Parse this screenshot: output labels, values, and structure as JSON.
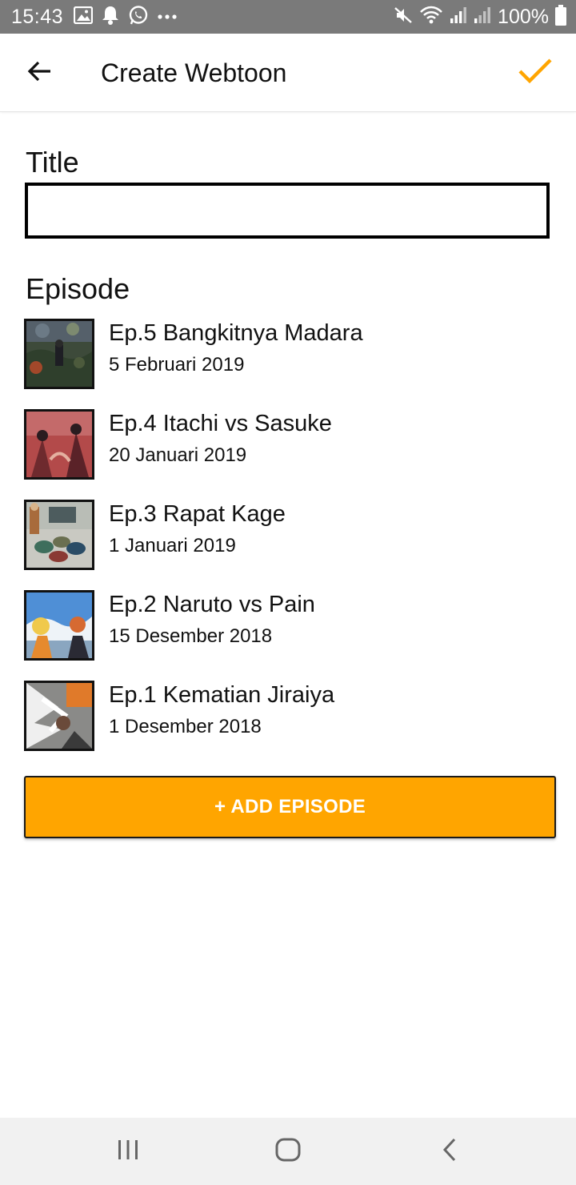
{
  "status_bar": {
    "time": "15:43",
    "battery": "100%",
    "icons_left": [
      "image-icon",
      "notification-bell-icon",
      "whatsapp-icon",
      "more-dots-icon"
    ],
    "icons_right": [
      "mute-icon",
      "wifi-icon",
      "signal-icon",
      "signal-icon",
      "battery-icon"
    ]
  },
  "app_bar": {
    "title": "Create Webtoon",
    "back_icon": "arrow-left-icon",
    "confirm_icon": "check-icon"
  },
  "form": {
    "title_label": "Title",
    "title_value": "",
    "episode_label": "Episode"
  },
  "episodes": [
    {
      "title": "Ep.5 Bangkitnya Madara",
      "date": "5 Februari 2019"
    },
    {
      "title": "Ep.4 Itachi vs Sasuke",
      "date": "20 Januari 2019"
    },
    {
      "title": "Ep.3 Rapat Kage",
      "date": "1 Januari 2019"
    },
    {
      "title": "Ep.2 Naruto vs Pain",
      "date": "15 Desember 2018"
    },
    {
      "title": "Ep.1 Kematian Jiraiya",
      "date": "1 Desember 2018"
    }
  ],
  "add_button": {
    "label": "+ ADD EPISODE"
  },
  "colors": {
    "accent": "#ffa500",
    "status_bar": "#7a7a7a",
    "nav_bar": "#f1f1f1"
  },
  "nav_bar": [
    "recents-icon",
    "home-icon",
    "back-chevron-icon"
  ]
}
